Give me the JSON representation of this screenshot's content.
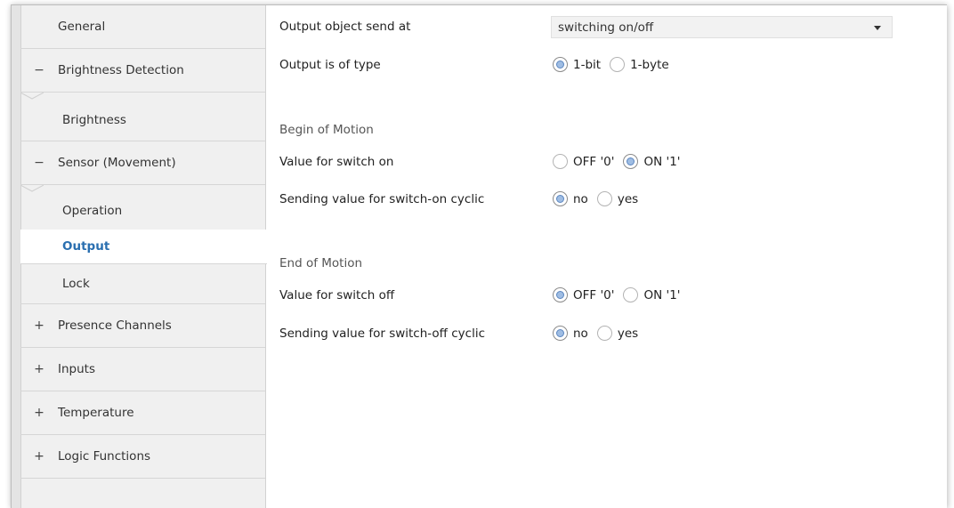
{
  "sidebar": {
    "items": [
      {
        "label": "General",
        "sign": ""
      },
      {
        "label": "Brightness Detection",
        "sign": "−"
      },
      {
        "label": "Brightness",
        "sign": ""
      },
      {
        "label": "Sensor (Movement)",
        "sign": "−"
      },
      {
        "label": "Operation",
        "sign": ""
      },
      {
        "label": "Output",
        "sign": ""
      },
      {
        "label": "Lock",
        "sign": ""
      },
      {
        "label": "Presence Channels",
        "sign": "+"
      },
      {
        "label": "Inputs",
        "sign": "+"
      },
      {
        "label": "Temperature",
        "sign": "+"
      },
      {
        "label": "Logic Functions",
        "sign": "+"
      }
    ],
    "selected": "Output"
  },
  "main": {
    "output_send": {
      "label": "Output object send at",
      "value": "switching on/off"
    },
    "output_type": {
      "label": "Output is of type",
      "options": [
        "1-bit",
        "1-byte"
      ],
      "selected": "1-bit"
    },
    "begin_section": "Begin of Motion",
    "switch_on": {
      "label": "Value for switch on",
      "options": [
        "OFF '0'",
        "ON '1'"
      ],
      "selected": "ON '1'"
    },
    "switch_on_cyclic": {
      "label": "Sending value for switch-on cyclic",
      "options": [
        "no",
        "yes"
      ],
      "selected": "no"
    },
    "end_section": "End of Motion",
    "switch_off": {
      "label": "Value for switch off",
      "options": [
        "OFF '0'",
        "ON '1'"
      ],
      "selected": "OFF '0'"
    },
    "switch_off_cyclic": {
      "label": "Sending value for switch-off cyclic",
      "options": [
        "no",
        "yes"
      ],
      "selected": "no"
    }
  },
  "colors": {
    "accent": "#2a6fb0",
    "radio_fill": "#9fbde3",
    "sidebar_bg": "#f0f0f0"
  }
}
